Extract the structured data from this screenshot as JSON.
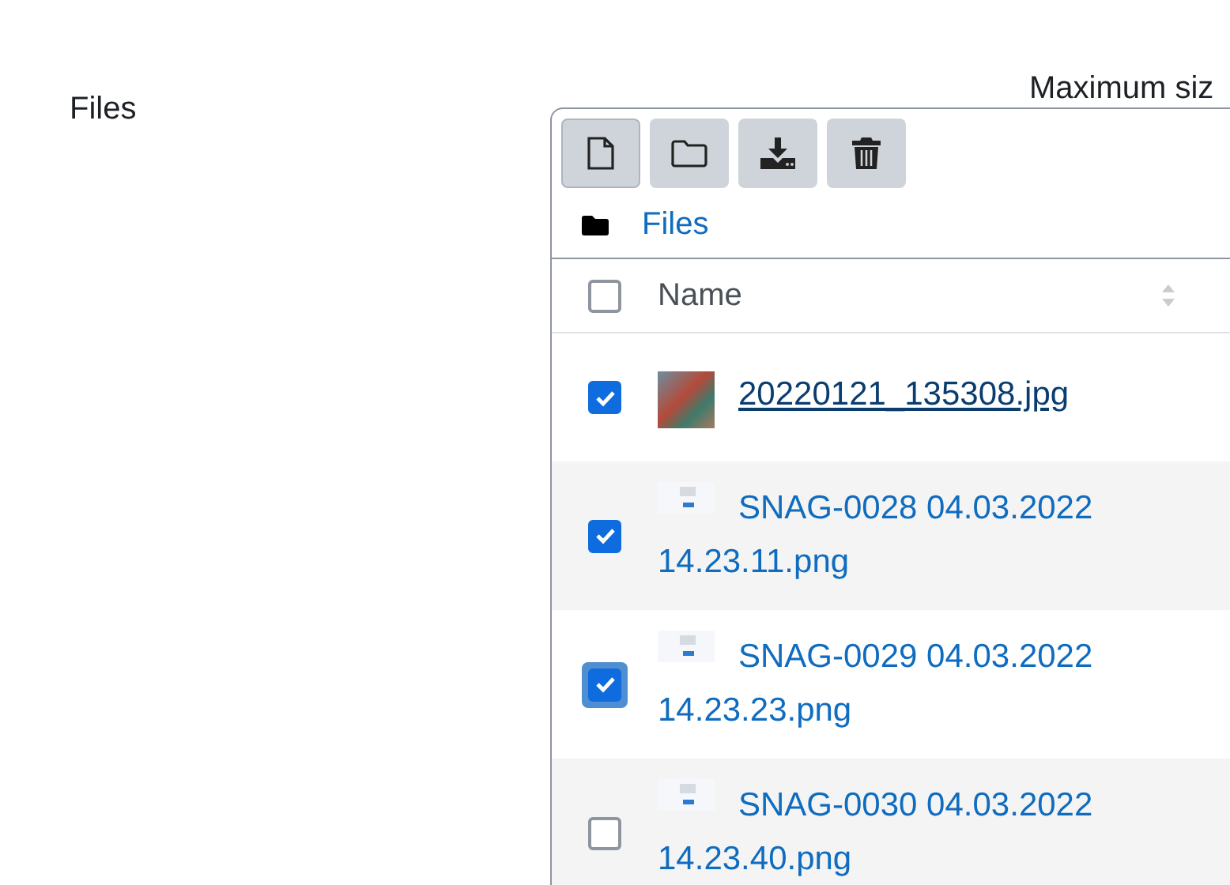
{
  "field_label": "Files",
  "max_size_note": "Maximum siz",
  "toolbar": [
    {
      "kind": "file"
    },
    {
      "kind": "folder"
    },
    {
      "kind": "download"
    },
    {
      "kind": "delete"
    }
  ],
  "breadcrumb": "Files",
  "table": {
    "select_all": {
      "checked": false
    },
    "columns": [
      "Name"
    ],
    "rows": [
      {
        "name": "20220121_135308.jpg",
        "checked": true,
        "focused": false,
        "hovered": true,
        "kind": "photo"
      },
      {
        "name": "SNAG-0028 04.03.2022 14.23.11.png",
        "checked": true,
        "focused": false,
        "hovered": false,
        "kind": "screenshot"
      },
      {
        "name": "SNAG-0029 04.03.2022 14.23.23.png",
        "checked": true,
        "focused": true,
        "hovered": false,
        "kind": "screenshot"
      },
      {
        "name": "SNAG-0030 04.03.2022 14.23.40.png",
        "checked": false,
        "focused": false,
        "hovered": false,
        "kind": "screenshot"
      }
    ]
  }
}
